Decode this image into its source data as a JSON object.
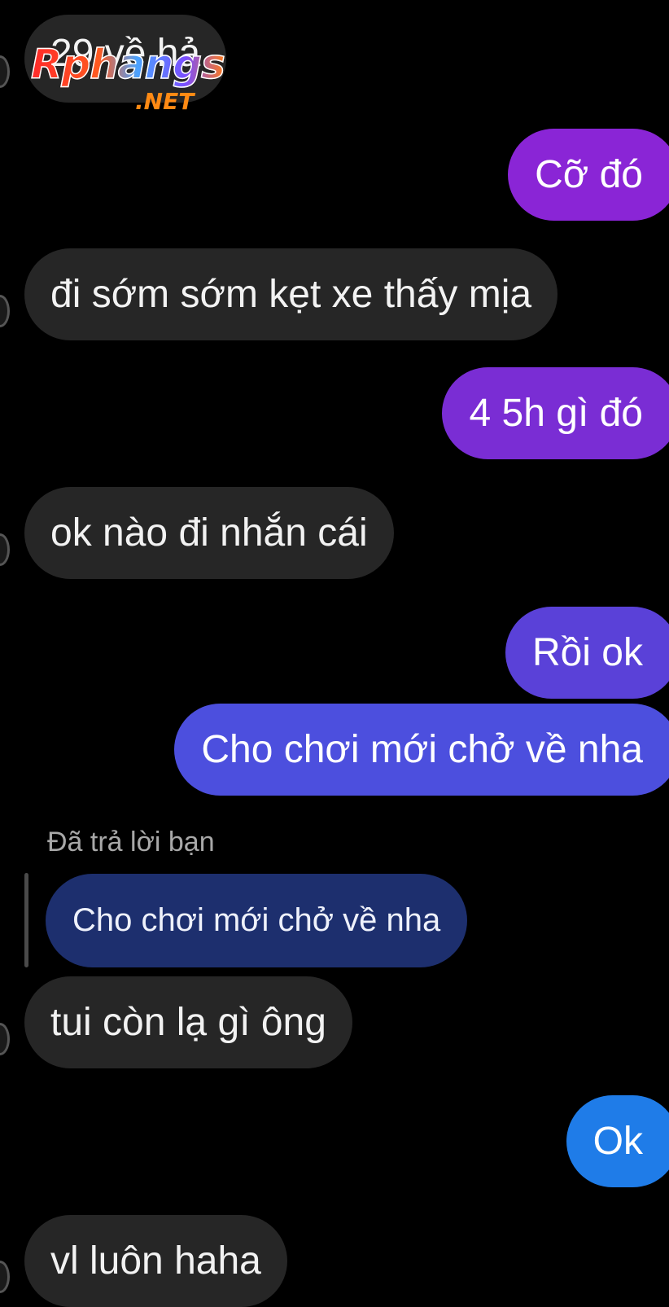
{
  "conversation": {
    "messages": [
      {
        "id": "m1",
        "sender": "them",
        "text": "29 về hả"
      },
      {
        "id": "m2",
        "sender": "me",
        "text": "Cỡ đó",
        "color": "#8a25d6"
      },
      {
        "id": "m3",
        "sender": "them",
        "text": "đi sớm sớm kẹt xe thấy mịa"
      },
      {
        "id": "m4",
        "sender": "me",
        "text": "4 5h gì đó",
        "color": "#7a2dd4"
      },
      {
        "id": "m5",
        "sender": "them",
        "text": "ok nào đi nhắn cái"
      },
      {
        "id": "m6",
        "sender": "me",
        "text": "Rồi ok",
        "color": "#5a41d8"
      },
      {
        "id": "m7",
        "sender": "me",
        "text": "Cho chơi mới chở về nha",
        "color": "#4c4fde"
      },
      {
        "id": "m8",
        "sender": "them",
        "text": "tui còn lạ gì ông",
        "reply": {
          "label": "Đã trả lời bạn",
          "quoted": "Cho chơi mới chở về nha"
        }
      },
      {
        "id": "m9",
        "sender": "me",
        "text": "Ok",
        "color": "#1f7ce8"
      },
      {
        "id": "m10",
        "sender": "them",
        "text": "vl luôn haha"
      }
    ]
  },
  "watermark": {
    "main": "Rphangs",
    "sub": ".NET"
  },
  "colors": {
    "background": "#000000",
    "incoming_bubble": "#262626",
    "reply_quote_bubble": "#1d2f6e",
    "reply_label": "#a8a8a8"
  }
}
